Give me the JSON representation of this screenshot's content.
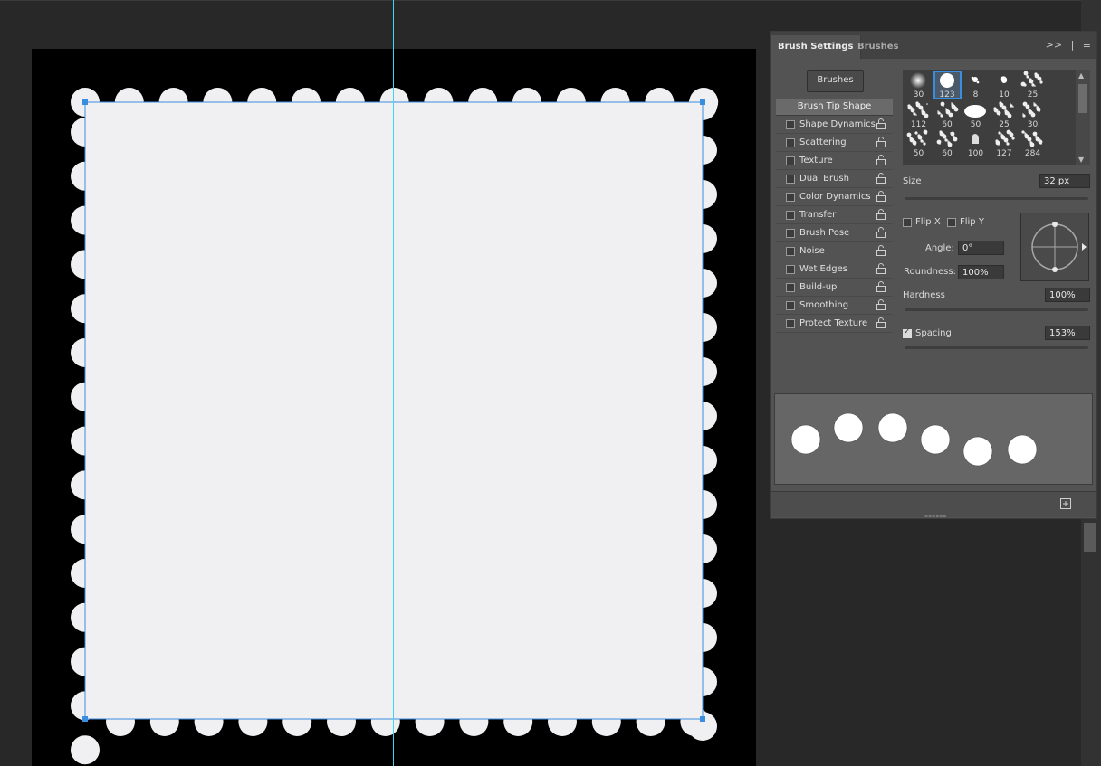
{
  "panel": {
    "tabs": [
      {
        "label": "Brush Settings",
        "active": true
      },
      {
        "label": "Brushes",
        "active": false
      }
    ],
    "collapse_icon": ">>",
    "menu_icon": "menu-icon",
    "brushes_button": "Brushes",
    "options_header": "Brush Tip Shape",
    "options": [
      {
        "label": "Shape Dynamics",
        "checked": false
      },
      {
        "label": "Scattering",
        "checked": false
      },
      {
        "label": "Texture",
        "checked": false
      },
      {
        "label": "Dual Brush",
        "checked": false
      },
      {
        "label": "Color Dynamics",
        "checked": false
      },
      {
        "label": "Transfer",
        "checked": false
      },
      {
        "label": "Brush Pose",
        "checked": false
      },
      {
        "label": "Noise",
        "checked": false
      },
      {
        "label": "Wet Edges",
        "checked": false
      },
      {
        "label": "Build-up",
        "checked": false
      },
      {
        "label": "Smoothing",
        "checked": false
      },
      {
        "label": "Protect Texture",
        "checked": false
      }
    ],
    "presets": [
      {
        "size": "30",
        "shape": "soft"
      },
      {
        "size": "123",
        "shape": "hard",
        "selected": true
      },
      {
        "size": "8",
        "shape": "splat"
      },
      {
        "size": "10",
        "shape": "blob"
      },
      {
        "size": "25",
        "shape": "spray"
      },
      {
        "size": "112",
        "shape": "speckle"
      },
      {
        "size": "60",
        "shape": "texture"
      },
      {
        "size": "50",
        "shape": "ellipse"
      },
      {
        "size": "25",
        "shape": "chalk"
      },
      {
        "size": "30",
        "shape": "fuzzy"
      },
      {
        "size": "50",
        "shape": "dry"
      },
      {
        "size": "60",
        "shape": "dry"
      },
      {
        "size": "100",
        "shape": "bristle"
      },
      {
        "size": "127",
        "shape": "dry"
      },
      {
        "size": "284",
        "shape": "scatter"
      }
    ],
    "size_label": "Size",
    "size_value": "32 px",
    "size_fraction": 0.16,
    "flip_x": "Flip X",
    "flip_y": "Flip Y",
    "angle_label": "Angle:",
    "angle_value": "0°",
    "roundness_label": "Roundness:",
    "roundness_value": "100%",
    "hardness_label": "Hardness",
    "hardness_value": "100%",
    "hardness_fraction": 1.0,
    "spacing_label": "Spacing",
    "spacing_checked": true,
    "spacing_value": "153%",
    "spacing_fraction": 0.63
  },
  "colors": {
    "workspace": "#282828",
    "canvas": "#000000",
    "stamp_fill": "#f0f0f2",
    "guide": "#3fd4ef",
    "selection": "#3a8ee0",
    "panel": "#535353"
  }
}
